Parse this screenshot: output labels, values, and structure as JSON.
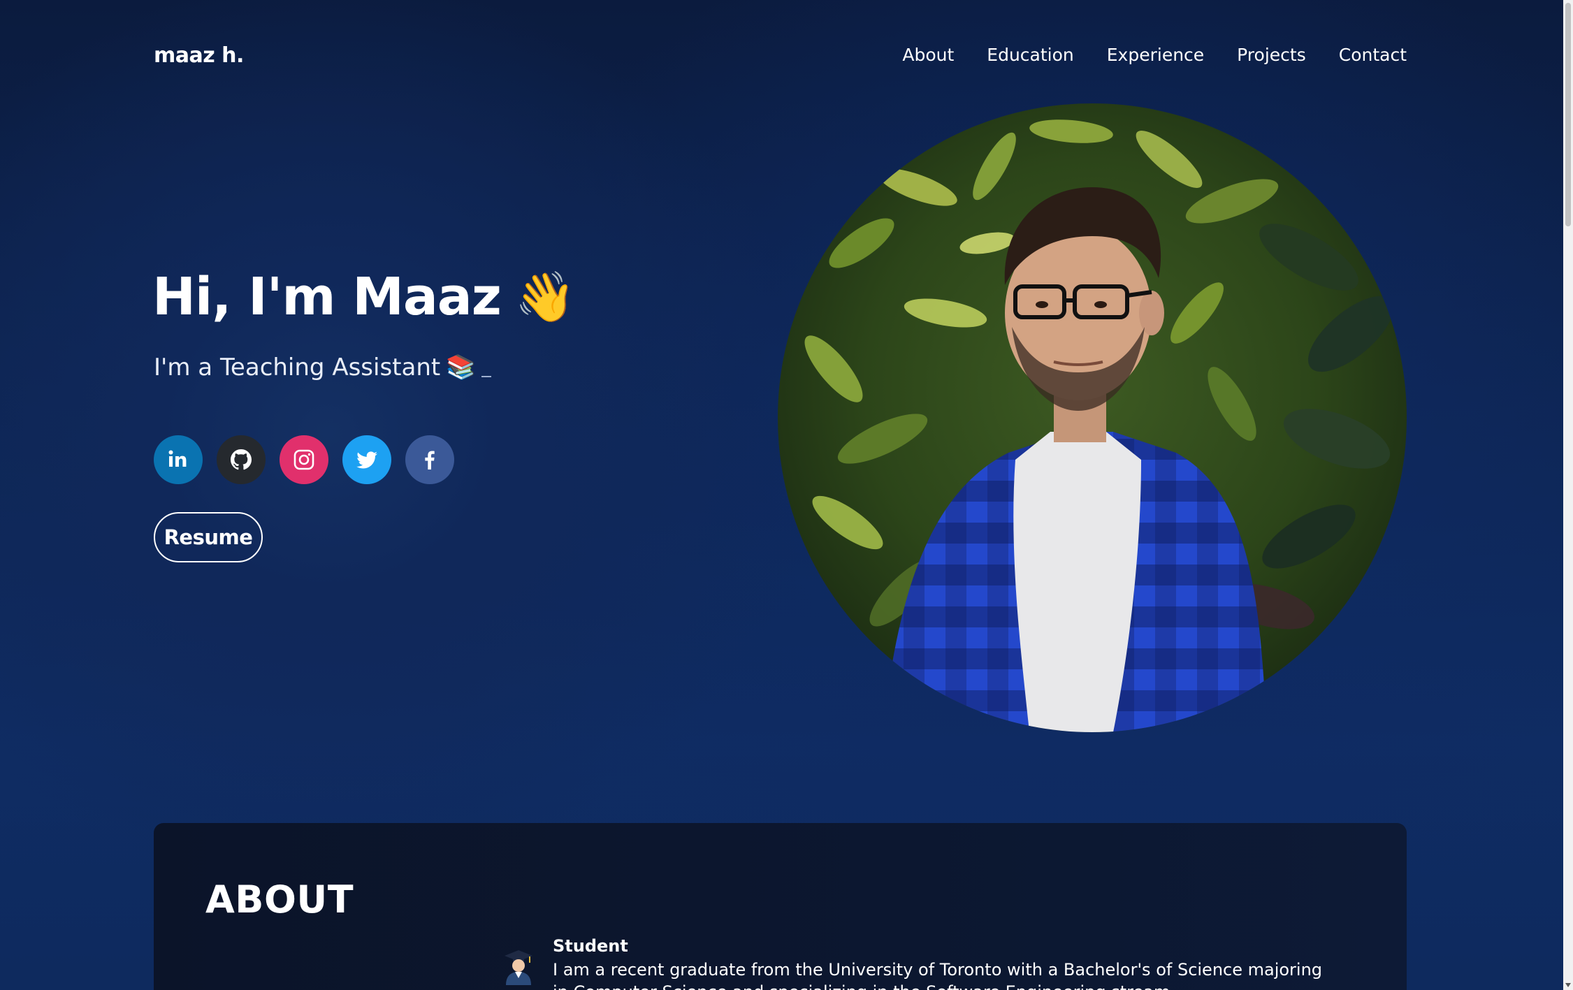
{
  "header": {
    "logo": "maaz h.",
    "nav": [
      "About",
      "Education",
      "Experience",
      "Projects",
      "Contact"
    ]
  },
  "hero": {
    "greeting": "Hi, I'm Maaz",
    "greeting_emoji": "👋",
    "subtitle": "I'm a Teaching Assistant",
    "subtitle_emoji": "📚",
    "socials": [
      {
        "name": "linkedin-icon",
        "color": "#0a73b1",
        "glyph": "in"
      },
      {
        "name": "github-icon",
        "color": "#25292e"
      },
      {
        "name": "instagram-icon",
        "color": "#e1306c"
      },
      {
        "name": "twitter-icon",
        "color": "#1da1f2"
      },
      {
        "name": "facebook-icon",
        "color": "#3b5998",
        "glyph": "f"
      }
    ],
    "resume_label": "Resume"
  },
  "about": {
    "title": "ABOUT",
    "items": [
      {
        "icon": "graduate-icon",
        "title": "Student",
        "text": "I am a recent graduate from the University of Toronto with a Bachelor's of Science majoring in Computer Science and specializing in the Software Engineering stream."
      }
    ]
  },
  "colors": {
    "background": "#0d2553",
    "card": "#0b1429",
    "text": "#ffffff"
  }
}
